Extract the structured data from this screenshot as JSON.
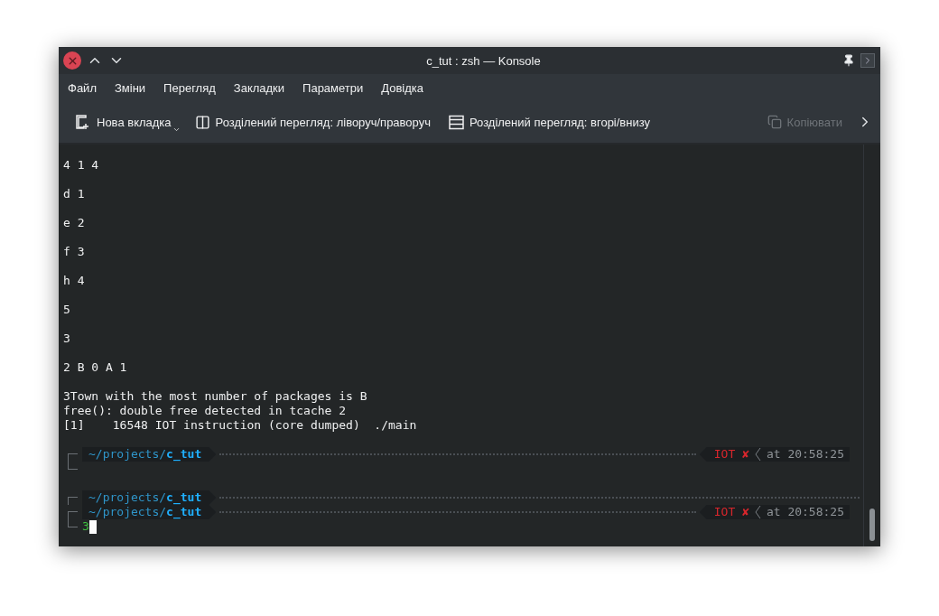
{
  "window": {
    "title": "c_tut : zsh — Konsole"
  },
  "menu": [
    "Файл",
    "Зміни",
    "Перегляд",
    "Закладки",
    "Параметри",
    "Довідка"
  ],
  "toolbar": [
    {
      "kind": "new-tab",
      "label": "Нова вкладка",
      "disabled": false,
      "dropdown": true
    },
    {
      "kind": "split-columns",
      "label": "Розділений перегляд: ліворуч/праворуч",
      "disabled": false,
      "dropdown": false
    },
    {
      "kind": "split-rows",
      "label": "Розділений перегляд: вгорі/внизу",
      "disabled": false,
      "dropdown": false
    },
    {
      "kind": "copy",
      "label": "Копіювати",
      "disabled": true,
      "dropdown": false
    }
  ],
  "terminal": {
    "lines": [
      {
        "kind": "text",
        "text": "4 1 4"
      },
      {
        "kind": "blank"
      },
      {
        "kind": "text",
        "text": "d 1"
      },
      {
        "kind": "blank"
      },
      {
        "kind": "text",
        "text": "e 2"
      },
      {
        "kind": "blank"
      },
      {
        "kind": "text",
        "text": "f 3"
      },
      {
        "kind": "blank"
      },
      {
        "kind": "text",
        "text": "h 4"
      },
      {
        "kind": "blank"
      },
      {
        "kind": "text",
        "text": "5"
      },
      {
        "kind": "blank"
      },
      {
        "kind": "text",
        "text": "3"
      },
      {
        "kind": "blank"
      },
      {
        "kind": "text",
        "text": "2 B 0 A 1"
      },
      {
        "kind": "blank"
      },
      {
        "kind": "text",
        "text": "3Town with the most number of packages is B"
      },
      {
        "kind": "text",
        "text": "free(): double free detected in tcache 2"
      },
      {
        "kind": "text",
        "text": "[1]    16548 IOT instruction (core dumped)  ./main"
      },
      {
        "kind": "blank"
      },
      {
        "kind": "prompt",
        "dir": "~/projects/",
        "leaf": "c_tut",
        "status": "IOT",
        "status_mark": "✘",
        "time_prefix": "at",
        "time": "20:58:25"
      },
      {
        "kind": "input",
        "cursor": false
      },
      {
        "kind": "blank"
      },
      {
        "kind": "prompt",
        "dir": "~/projects/",
        "leaf": "c_tut"
      },
      {
        "kind": "prompt",
        "dir": "~/projects/",
        "leaf": "c_tut",
        "status": "IOT",
        "status_mark": "✘",
        "time_prefix": "at",
        "time": "20:58:25"
      },
      {
        "kind": "input",
        "text": "3",
        "cursor": true
      }
    ]
  }
}
